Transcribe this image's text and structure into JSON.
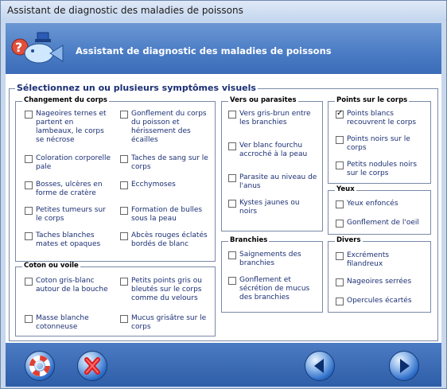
{
  "window": {
    "title": "Assistant de diagnostic des maladies de poissons"
  },
  "banner": {
    "title": "Assistant de diagnostic des maladies de poissons"
  },
  "main": {
    "heading": "Sélectionnez un ou plusieurs symptômes visuels"
  },
  "groups": {
    "corps": {
      "title": "Changement du corps",
      "items": [
        {
          "label": "Nageoires ternes et partent en lambeaux, le corps se nécrose",
          "checked": false
        },
        {
          "label": "Gonflement du corps du poisson et hérissement des écailles",
          "checked": false
        },
        {
          "label": "Coloration corporelle pale",
          "checked": false
        },
        {
          "label": "Taches de sang sur le corps",
          "checked": false
        },
        {
          "label": "Bosses, ulcères en forme de cratère",
          "checked": false
        },
        {
          "label": "Ecchymoses",
          "checked": false
        },
        {
          "label": "Petites tumeurs sur le corps",
          "checked": false
        },
        {
          "label": "Formation de bulles sous la peau",
          "checked": false
        },
        {
          "label": "Taches blanches mates et opaques",
          "checked": false
        },
        {
          "label": "Abcès rouges éclatés bordés de blanc",
          "checked": false
        }
      ]
    },
    "coton": {
      "title": "Coton ou voile",
      "items": [
        {
          "label": "Coton gris-blanc autour de la bouche",
          "checked": false
        },
        {
          "label": "Petits points gris ou bleutés sur le corps comme du velours",
          "checked": false
        },
        {
          "label": "Masse blanche cotonneuse",
          "checked": false
        },
        {
          "label": "Mucus grisâtre sur le corps",
          "checked": false
        }
      ]
    },
    "vers": {
      "title": "Vers ou parasites",
      "items": [
        {
          "label": "Vers gris-brun entre les branchies",
          "checked": false
        },
        {
          "label": "Ver blanc fourchu accroché à la peau",
          "checked": false
        },
        {
          "label": "Parasite au niveau de l'anus",
          "checked": false
        },
        {
          "label": "Kystes jaunes ou noirs",
          "checked": false
        }
      ]
    },
    "branchies": {
      "title": "Branchies",
      "items": [
        {
          "label": "Saignements des branchies",
          "checked": false
        },
        {
          "label": "Gonflement et sécrétion de mucus des branchies",
          "checked": false
        }
      ]
    },
    "points": {
      "title": "Points sur le corps",
      "items": [
        {
          "label": "Points blancs recouvrent le corps",
          "checked": true
        },
        {
          "label": "Points noirs sur le corps",
          "checked": false
        },
        {
          "label": "Petits nodules noirs sur le corps",
          "checked": false
        }
      ]
    },
    "yeux": {
      "title": "Yeux",
      "items": [
        {
          "label": "Yeux enfoncés",
          "checked": false
        },
        {
          "label": "Gonflement de l'oeil",
          "checked": false
        }
      ]
    },
    "divers": {
      "title": "Divers",
      "items": [
        {
          "label": "Excréments filandreux",
          "checked": false
        },
        {
          "label": "Nageoires serrées",
          "checked": false
        },
        {
          "label": "Opercules écartés",
          "checked": false
        }
      ]
    }
  },
  "buttons": [
    {
      "name": "help",
      "icon": "lifebuoy-icon"
    },
    {
      "name": "cancel",
      "icon": "red-x-icon"
    },
    {
      "name": "back",
      "icon": "arrow-left-icon"
    },
    {
      "name": "next",
      "icon": "arrow-right-icon"
    }
  ],
  "colors": {
    "accent": "#2f6fc9",
    "label": "#1b2f73",
    "banner": "#4a7bc4"
  }
}
